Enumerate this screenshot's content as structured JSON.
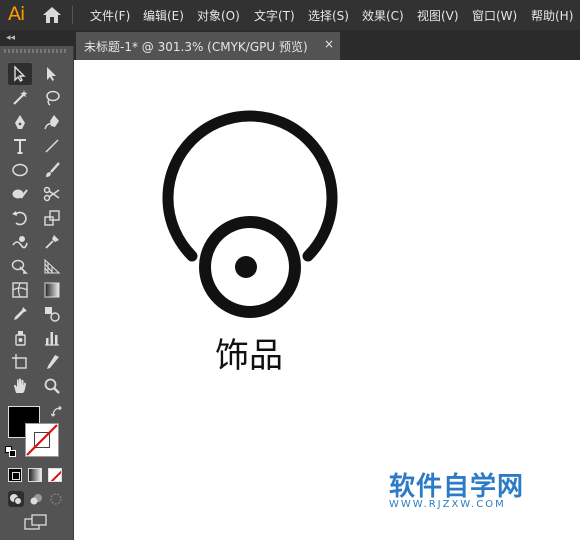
{
  "app": {
    "logo": "Ai",
    "home_icon": "home-icon"
  },
  "menu": [
    {
      "label": "文件(F)"
    },
    {
      "label": "编辑(E)"
    },
    {
      "label": "对象(O)"
    },
    {
      "label": "文字(T)"
    },
    {
      "label": "选择(S)"
    },
    {
      "label": "效果(C)"
    },
    {
      "label": "视图(V)"
    },
    {
      "label": "窗口(W)"
    },
    {
      "label": "帮助(H)"
    }
  ],
  "panel": {
    "collapse_label": "◂◂"
  },
  "document": {
    "tab_title": "未标题-1* @ 301.3% (CMYK/GPU 预览)",
    "close_label": "×"
  },
  "tools": [
    {
      "icon": "selection-tool-icon",
      "selected": true
    },
    {
      "icon": "direct-selection-tool-icon"
    },
    {
      "icon": "magic-wand-tool-icon"
    },
    {
      "icon": "lasso-tool-icon"
    },
    {
      "icon": "pen-tool-icon"
    },
    {
      "icon": "curvature-tool-icon"
    },
    {
      "icon": "type-tool-icon"
    },
    {
      "icon": "line-segment-tool-icon"
    },
    {
      "icon": "ellipse-tool-icon"
    },
    {
      "icon": "paintbrush-tool-icon"
    },
    {
      "icon": "shaper-tool-icon"
    },
    {
      "icon": "scissors-tool-icon"
    },
    {
      "icon": "rotate-tool-icon"
    },
    {
      "icon": "scale-tool-icon"
    },
    {
      "icon": "warp-tool-icon"
    },
    {
      "icon": "puppet-warp-tool-icon"
    },
    {
      "icon": "shape-builder-tool-icon"
    },
    {
      "icon": "perspective-grid-tool-icon"
    },
    {
      "icon": "mesh-tool-icon"
    },
    {
      "icon": "gradient-tool-icon"
    },
    {
      "icon": "eyedropper-tool-icon"
    },
    {
      "icon": "blend-tool-icon"
    },
    {
      "icon": "symbol-sprayer-tool-icon"
    },
    {
      "icon": "column-graph-tool-icon"
    },
    {
      "icon": "artboard-tool-icon"
    },
    {
      "icon": "slice-tool-icon"
    },
    {
      "icon": "hand-tool-icon"
    },
    {
      "icon": "zoom-tool-icon"
    }
  ],
  "colors": {
    "fill": "#000000",
    "stroke": "none",
    "ui_dark": "#323232",
    "ui_panel": "#535353",
    "accent_logo": "#ff9a00",
    "watermark": "#2b7bc6"
  },
  "artwork": {
    "label": "饰品"
  },
  "watermark": {
    "cn": "软件自学网",
    "en": "WWW.RJZXW.COM"
  }
}
